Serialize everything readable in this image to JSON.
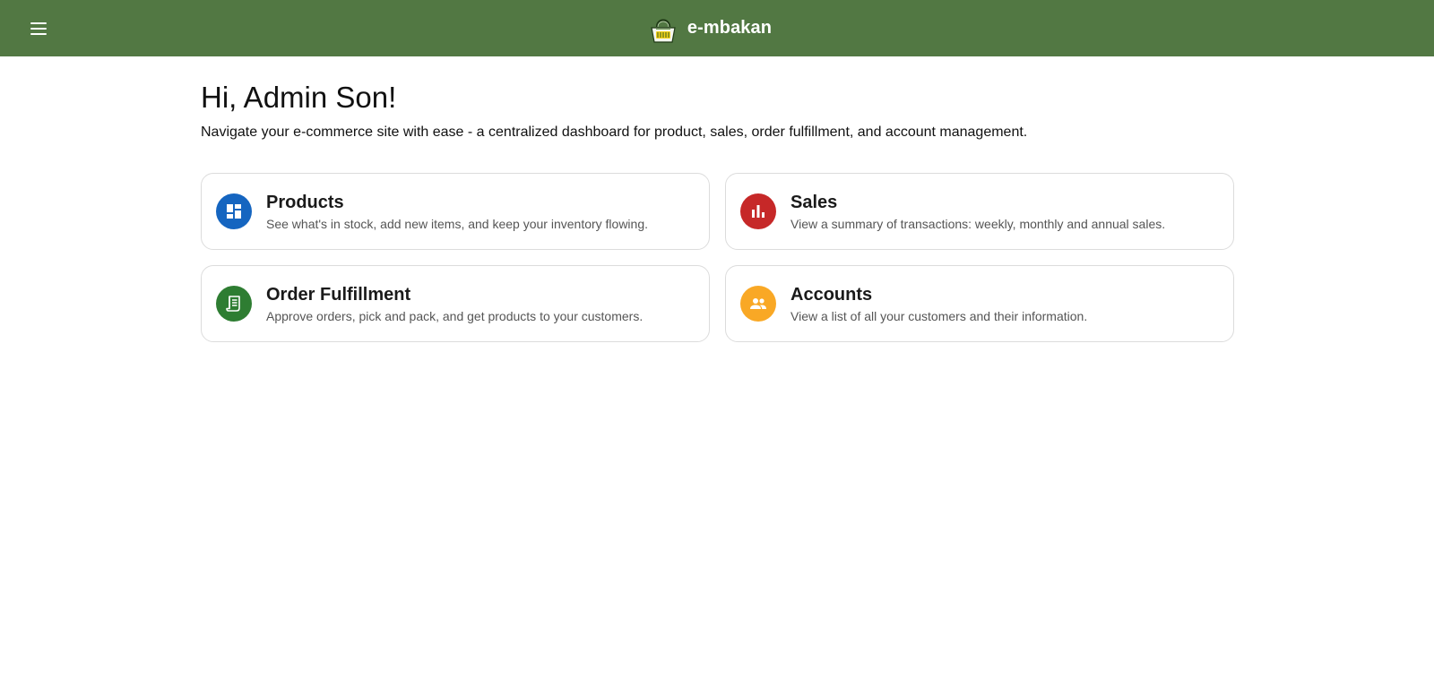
{
  "header": {
    "brand_name": "e-mbakan",
    "background_color": "#527843",
    "menu_icon": "hamburger-menu-icon",
    "logo_icon": "shopping-basket-icon"
  },
  "main": {
    "greeting": "Hi, Admin Son!",
    "subtitle": "Navigate your e-commerce site with ease - a centralized dashboard for product, sales, order fulfillment, and account management."
  },
  "cards": [
    {
      "title": "Products",
      "description": "See what's in stock, add new items, and keep your inventory flowing.",
      "icon": "dashboard-icon",
      "color": "#1565c0"
    },
    {
      "title": "Sales",
      "description": "View a summary of transactions: weekly, monthly and annual sales.",
      "icon": "bar-chart-icon",
      "color": "#c62828"
    },
    {
      "title": "Order Fulfillment",
      "description": "Approve orders, pick and pack, and get products to your customers.",
      "icon": "receipt-icon",
      "color": "#2e7d32"
    },
    {
      "title": "Accounts",
      "description": "View a list of all your customers and their information.",
      "icon": "people-icon",
      "color": "#f9a825"
    }
  ]
}
